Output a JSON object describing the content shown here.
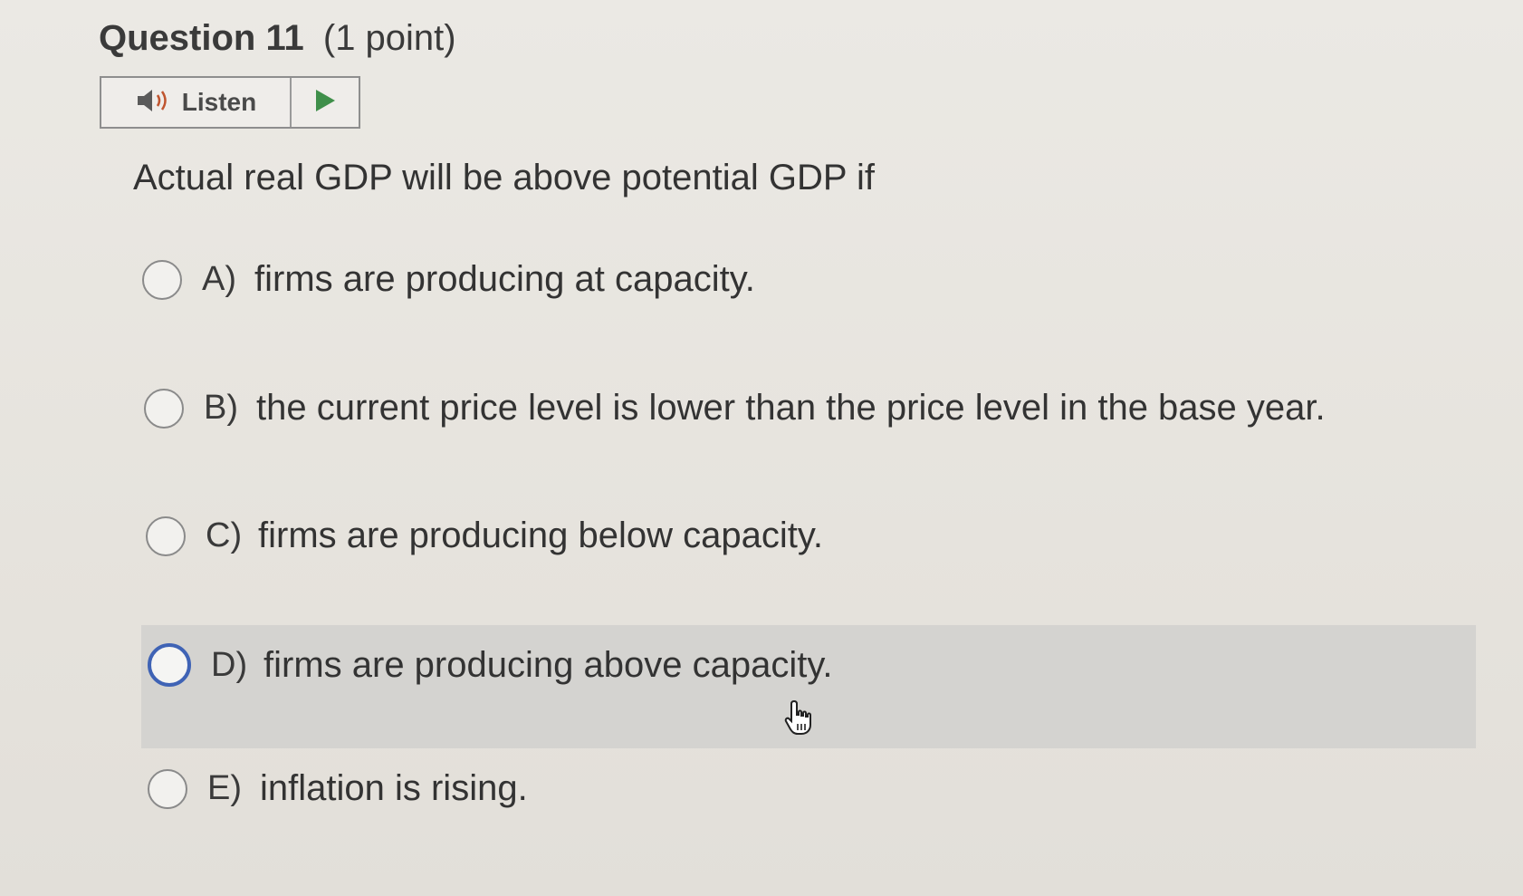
{
  "question": {
    "title": "Question 11",
    "points": "(1 point)"
  },
  "listen": {
    "label": "Listen",
    "speaker_icon": "speaker-icon",
    "play_icon": "play-icon"
  },
  "prompt": "Actual real GDP will be above potential GDP if",
  "options": [
    {
      "letter": "A)",
      "text": "firms are producing at capacity."
    },
    {
      "letter": "B)",
      "text": "the current price level is lower than the price level in the base year."
    },
    {
      "letter": "C)",
      "text": "firms are producing below capacity."
    },
    {
      "letter": "D)",
      "text": "firms are producing above capacity."
    },
    {
      "letter": "E)",
      "text": "inflation is rising."
    }
  ],
  "colors": {
    "accent": "#3f63b5",
    "play": "#3f8f4a",
    "highlight": "#d4d3d0"
  }
}
